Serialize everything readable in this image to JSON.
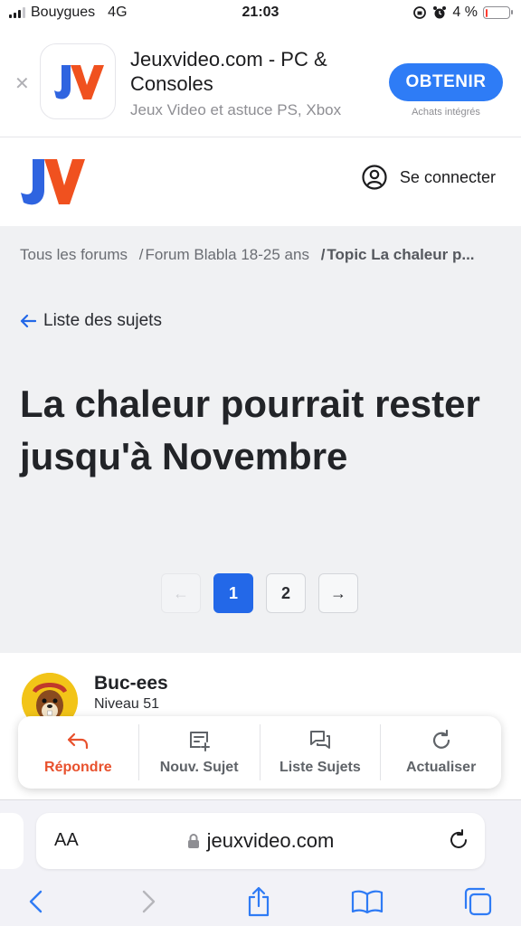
{
  "status_bar": {
    "carrier": "Bouygues",
    "network": "4G",
    "time": "21:03",
    "battery_text": "4 %",
    "battery_level": 0.04
  },
  "app_banner": {
    "title": "Jeuxvideo.com - PC & Consoles",
    "subtitle": "Jeux Video et astuce PS, Xbox",
    "get_button": "OBTENIR",
    "in_app_note": "Achats intégrés"
  },
  "header": {
    "login_label": "Se connecter"
  },
  "breadcrumb": {
    "items": [
      "Tous les forums",
      "Forum Blabla 18-25 ans",
      "Topic La chaleur p..."
    ],
    "separator": "/"
  },
  "back_link": "Liste des sujets",
  "topic_title": "La chaleur pourrait rester jusqu'à Novembre",
  "pagination": {
    "pages": [
      "1",
      "2"
    ],
    "current": "1",
    "prev_symbol": "←",
    "next_symbol": "→"
  },
  "post": {
    "author": "Buc-ees",
    "level": "Niveau 51"
  },
  "action_bar": {
    "reply": "Répondre",
    "new_topic": "Nouv. Sujet",
    "topic_list": "Liste Sujets",
    "refresh": "Actualiser"
  },
  "browser": {
    "aa_label": "AA",
    "url": "jeuxvideo.com"
  },
  "colors": {
    "accent_blue": "#2368e8",
    "reply_orange": "#e8512d",
    "app_store_blue": "#2e7cf6",
    "logo_blue": "#2f64e0",
    "logo_orange": "#f0511f"
  }
}
